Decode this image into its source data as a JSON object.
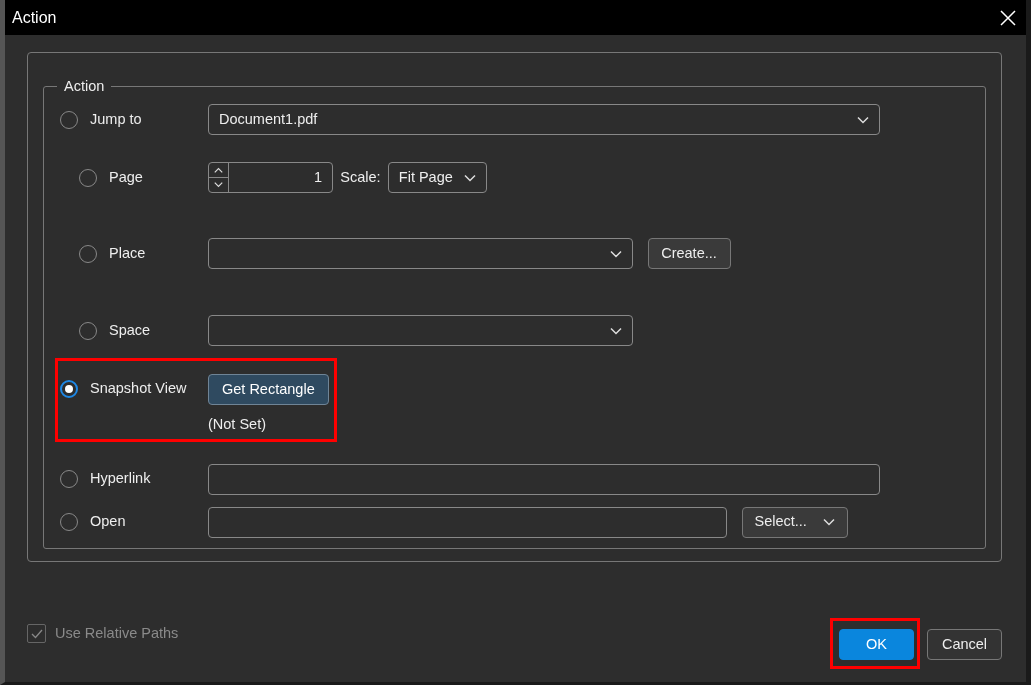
{
  "window": {
    "title": "Action"
  },
  "group": {
    "legend": "Action",
    "options": [
      {
        "kind": "combo",
        "label": "Jump to",
        "selected": false,
        "value": "Document1.pdf",
        "children": [
          {
            "kind": "page",
            "label": "Page",
            "selected": false,
            "spin_value": "1",
            "scale_label": "Scale:",
            "scale_value": "Fit Page"
          },
          {
            "kind": "combo_button",
            "label": "Place",
            "selected": false,
            "button": "Create..."
          },
          {
            "kind": "combo",
            "label": "Space",
            "selected": false
          }
        ]
      },
      {
        "kind": "snapshot",
        "label": "Snapshot View",
        "selected": true,
        "highlighted": true,
        "button": "Get Rectangle",
        "note": "(Not Set)"
      },
      {
        "kind": "text",
        "label": "Hyperlink",
        "selected": false
      },
      {
        "kind": "text_select",
        "label": "Open",
        "selected": false,
        "select": "Select..."
      }
    ]
  },
  "use_relative_paths": {
    "label": "Use Relative Paths",
    "checked": true,
    "disabled": true
  },
  "buttons": [
    {
      "label": "OK",
      "primary": true,
      "highlighted": true
    },
    {
      "label": "Cancel",
      "primary": false,
      "highlighted": false
    }
  ]
}
